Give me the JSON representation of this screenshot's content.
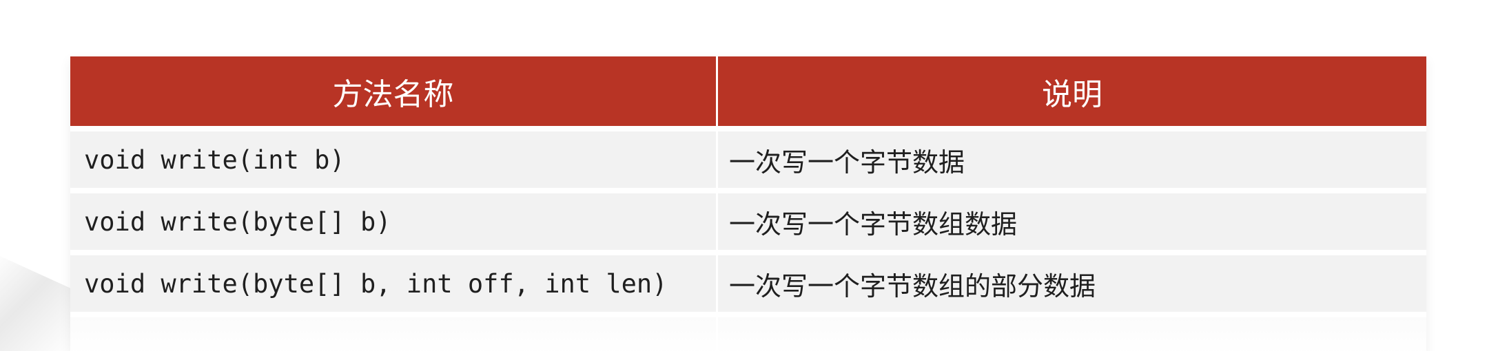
{
  "table": {
    "headers": {
      "method": "方法名称",
      "description": "说明"
    },
    "rows": [
      {
        "method": "void write(int b)",
        "description": "一次写一个字节数据"
      },
      {
        "method": "void write(byte[] b)",
        "description": "一次写一个字节数组数据"
      },
      {
        "method": "void write(byte[] b, int off, int len)",
        "description": "一次写一个字节数组的部分数据"
      }
    ],
    "colors": {
      "header_bg": "#b83425",
      "header_text": "#ffffff",
      "row_bg": "#f2f2f2"
    }
  }
}
